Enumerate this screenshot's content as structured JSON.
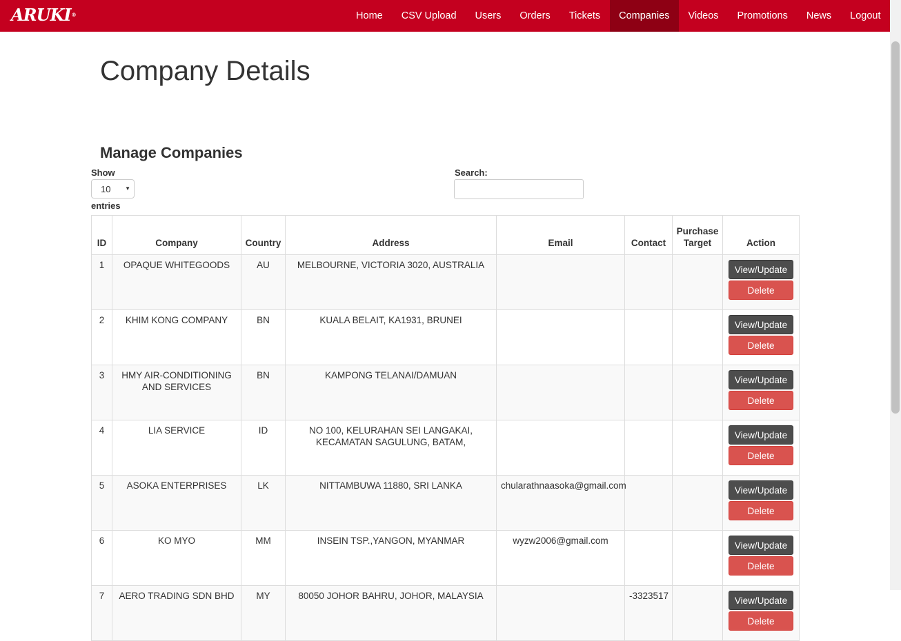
{
  "brand": "ARUKI",
  "nav": [
    "Home",
    "CSV Upload",
    "Users",
    "Orders",
    "Tickets",
    "Companies",
    "Videos",
    "Promotions",
    "News",
    "Logout"
  ],
  "nav_active": "Companies",
  "page_title": "Company Details",
  "section_title": "Manage Companies",
  "length": {
    "show": "Show",
    "value": "10",
    "entries": "entries"
  },
  "search": {
    "label": "Search:",
    "value": ""
  },
  "table": {
    "headers": [
      "ID",
      "Company",
      "Country",
      "Address",
      "Email",
      "Contact",
      "Purchase Target",
      "Action"
    ],
    "view_label": "View/Update",
    "delete_label": "Delete",
    "rows": [
      {
        "id": "1",
        "company": "OPAQUE WHITEGOODS",
        "country": "AU",
        "address": "MELBOURNE, VICTORIA 3020, AUSTRALIA",
        "email": "",
        "contact": "",
        "target": ""
      },
      {
        "id": "2",
        "company": "KHIM KONG COMPANY",
        "country": "BN",
        "address": "KUALA BELAIT, KA1931, BRUNEI",
        "email": "",
        "contact": "",
        "target": ""
      },
      {
        "id": "3",
        "company": "HMY AIR-CONDITIONING AND SERVICES",
        "country": "BN",
        "address": "KAMPONG TELANAI/DAMUAN",
        "email": "",
        "contact": "",
        "target": ""
      },
      {
        "id": "4",
        "company": "LIA SERVICE",
        "country": "ID",
        "address": "NO 100, KELURAHAN SEI LANGAKAI, KECAMATAN SAGULUNG, BATAM,",
        "email": "",
        "contact": "",
        "target": ""
      },
      {
        "id": "5",
        "company": "ASOKA ENTERPRISES",
        "country": "LK",
        "address": "NITTAMBUWA 11880, SRI LANKA",
        "email": "chularathnaasoka@gmail.com",
        "contact": "",
        "target": ""
      },
      {
        "id": "6",
        "company": "KO MYO",
        "country": "MM",
        "address": "INSEIN TSP.,YANGON, MYANMAR",
        "email": "wyzw2006@gmail.com",
        "contact": "",
        "target": ""
      },
      {
        "id": "7",
        "company": "AERO TRADING SDN BHD",
        "country": "MY",
        "address": "80050 JOHOR BAHRU, JOHOR, MALAYSIA",
        "email": "",
        "contact": "-3323517",
        "target": ""
      }
    ]
  },
  "colors": {
    "navbar": "#c4001f",
    "nav_active": "#8e0014",
    "view_button": "#4d4d4d",
    "delete_button": "#d9534f"
  }
}
